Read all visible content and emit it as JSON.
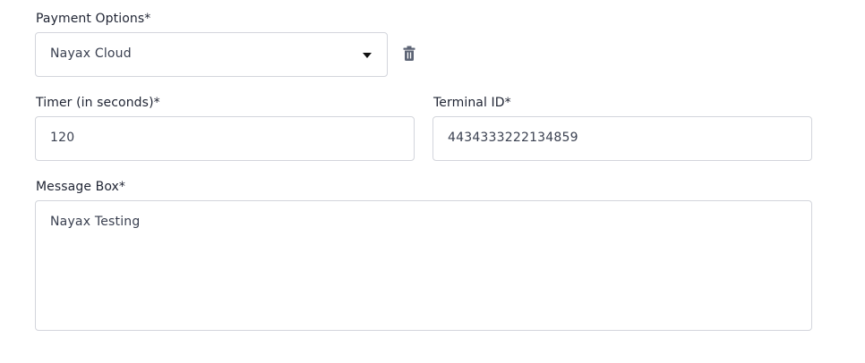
{
  "payment": {
    "label": "Payment Options*",
    "selected": "Nayax Cloud",
    "delete_icon": "trash-icon"
  },
  "timer": {
    "label": "Timer (in seconds)*",
    "value": "120"
  },
  "terminal": {
    "label": "Terminal ID*",
    "value": "4434333222134859"
  },
  "message": {
    "label": "Message Box*",
    "value": "Nayax Testing"
  }
}
